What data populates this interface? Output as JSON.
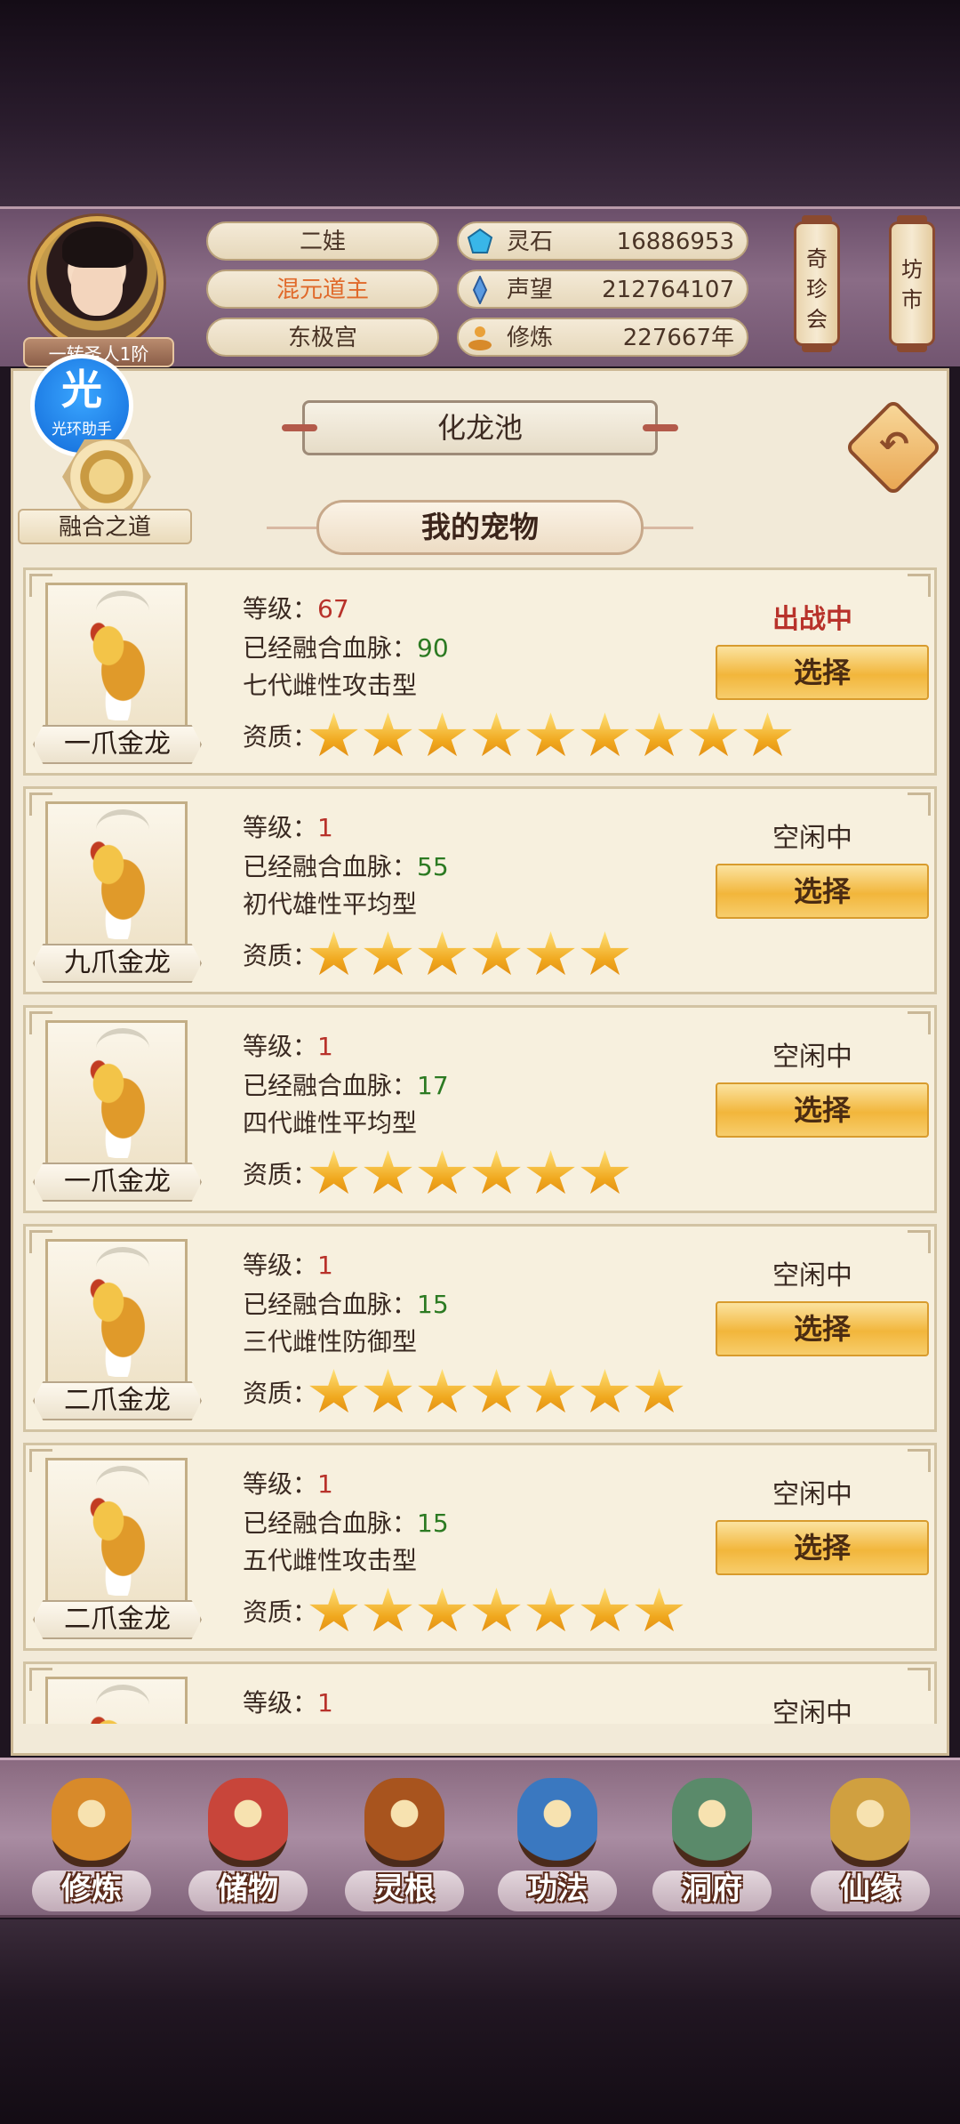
{
  "player": {
    "name": "二娃",
    "title": "混元道主",
    "sect": "东极宫",
    "rank": "一转圣人1阶"
  },
  "stats": [
    {
      "icon": "spirit-stone-icon",
      "label": "灵石",
      "value": "16886953"
    },
    {
      "icon": "reputation-icon",
      "label": "声望",
      "value": "212764107"
    },
    {
      "icon": "cultivation-icon",
      "label": "修炼",
      "value": "227667年"
    }
  ],
  "side_buttons": {
    "treasure": "奇珍会",
    "market": "坊市"
  },
  "helper": {
    "glyph": "光",
    "label": "光环助手"
  },
  "fusion": {
    "label": "融合之道"
  },
  "page": {
    "title": "化龙池",
    "tab": "我的宠物"
  },
  "labels": {
    "level": "等级：",
    "bloodline": "已经融合血脉：",
    "quality": "资质：",
    "select": "选择"
  },
  "pets": [
    {
      "name": "一爪金龙",
      "level": "67",
      "bloodline": "90",
      "type": "七代雌性攻击型",
      "status": "出战中",
      "active": true,
      "stars": 9
    },
    {
      "name": "九爪金龙",
      "level": "1",
      "bloodline": "55",
      "type": "初代雄性平均型",
      "status": "空闲中",
      "active": false,
      "stars": 6
    },
    {
      "name": "一爪金龙",
      "level": "1",
      "bloodline": "17",
      "type": "四代雌性平均型",
      "status": "空闲中",
      "active": false,
      "stars": 6
    },
    {
      "name": "二爪金龙",
      "level": "1",
      "bloodline": "15",
      "type": "三代雌性防御型",
      "status": "空闲中",
      "active": false,
      "stars": 7
    },
    {
      "name": "二爪金龙",
      "level": "1",
      "bloodline": "15",
      "type": "五代雌性攻击型",
      "status": "空闲中",
      "active": false,
      "stars": 7
    },
    {
      "name": "",
      "level": "1",
      "bloodline": "",
      "type": "",
      "status": "空闲中",
      "active": false,
      "stars": 0
    }
  ],
  "nav": [
    {
      "label": "修炼",
      "icon": "cultivate-icon",
      "color": "#d88a2a"
    },
    {
      "label": "储物",
      "icon": "storage-bag-icon",
      "color": "#c8453a"
    },
    {
      "label": "灵根",
      "icon": "spirit-root-icon",
      "color": "#a8541e"
    },
    {
      "label": "功法",
      "icon": "scripture-book-icon",
      "color": "#3a78c0"
    },
    {
      "label": "洞府",
      "icon": "cave-mansion-icon",
      "color": "#5a8a6a"
    },
    {
      "label": "仙缘",
      "icon": "gourd-icon",
      "color": "#d0a040"
    }
  ],
  "colors": {
    "active_status": "#b8322a",
    "level_value": "#b8322a",
    "bloodline_value": "#2c7a22",
    "button_gold": "#f2b63b"
  }
}
